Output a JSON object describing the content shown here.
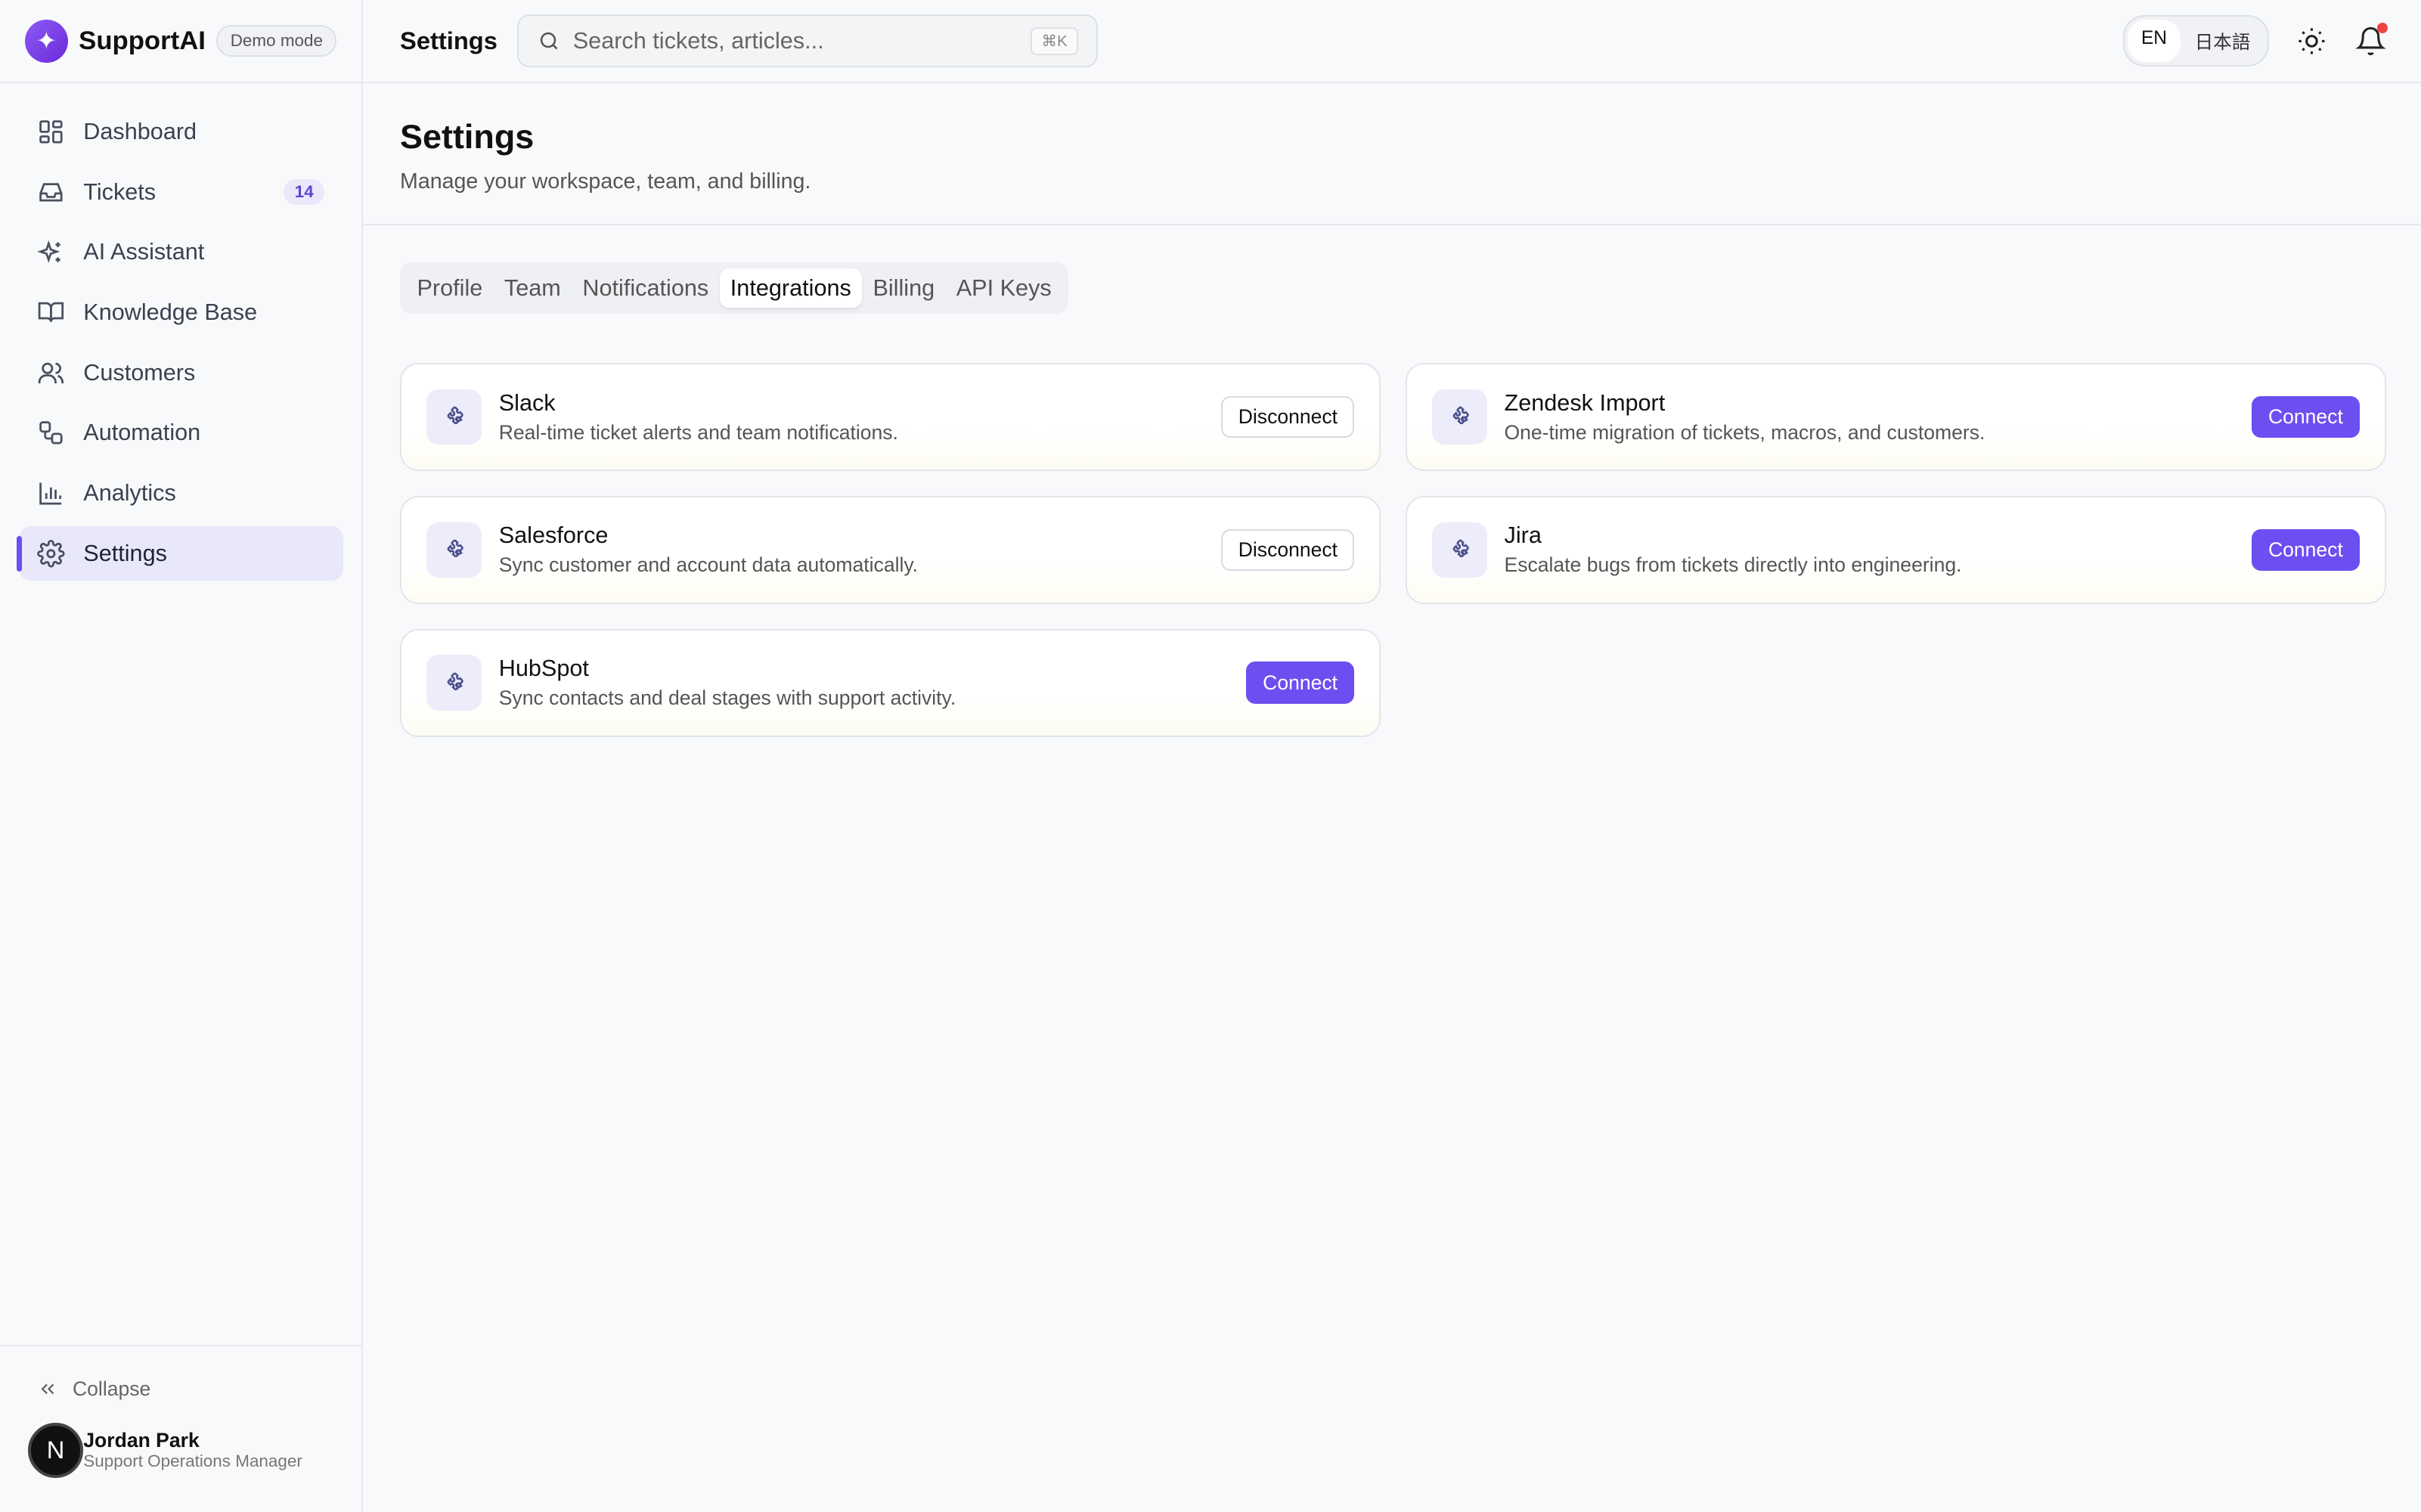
{
  "brand": {
    "name": "SupportAI",
    "logo_glyph": "✦",
    "badge": "Demo mode"
  },
  "sidebar": {
    "items": [
      {
        "label": "Dashboard",
        "icon": "dashboard-icon"
      },
      {
        "label": "Tickets",
        "icon": "inbox-icon",
        "count": "14"
      },
      {
        "label": "AI Assistant",
        "icon": "sparkles-icon"
      },
      {
        "label": "Knowledge Base",
        "icon": "book-icon"
      },
      {
        "label": "Customers",
        "icon": "users-icon"
      },
      {
        "label": "Automation",
        "icon": "workflow-icon"
      },
      {
        "label": "Analytics",
        "icon": "bar-chart-icon"
      },
      {
        "label": "Settings",
        "icon": "gear-icon",
        "active": true
      }
    ],
    "collapse_label": "Collapse",
    "user": {
      "initial": "N",
      "name": "Jordan Park",
      "role": "Support Operations Manager"
    }
  },
  "topbar": {
    "title": "Settings",
    "search_placeholder": "Search tickets, articles...",
    "shortcut": "⌘K",
    "languages": [
      "EN",
      "日本語"
    ],
    "active_language": "EN"
  },
  "page": {
    "title": "Settings",
    "subtitle": "Manage your workspace, team, and billing."
  },
  "tabs": [
    "Profile",
    "Team",
    "Notifications",
    "Integrations",
    "Billing",
    "API Keys"
  ],
  "active_tab": "Integrations",
  "integrations": [
    {
      "name": "Slack",
      "desc": "Real-time ticket alerts and team notifications.",
      "action": "Disconnect",
      "connected": true
    },
    {
      "name": "Zendesk Import",
      "desc": "One-time migration of tickets, macros, and customers.",
      "action": "Connect",
      "connected": false
    },
    {
      "name": "Salesforce",
      "desc": "Sync customer and account data automatically.",
      "action": "Disconnect",
      "connected": true
    },
    {
      "name": "Jira",
      "desc": "Escalate bugs from tickets directly into engineering.",
      "action": "Connect",
      "connected": false
    },
    {
      "name": "HubSpot",
      "desc": "Sync contacts and deal stages with support activity.",
      "action": "Connect",
      "connected": false
    }
  ],
  "colors": {
    "accent": "#6d4ef0",
    "active_nav_bg": "#e8e8fa",
    "notification_dot": "#ef4444"
  }
}
